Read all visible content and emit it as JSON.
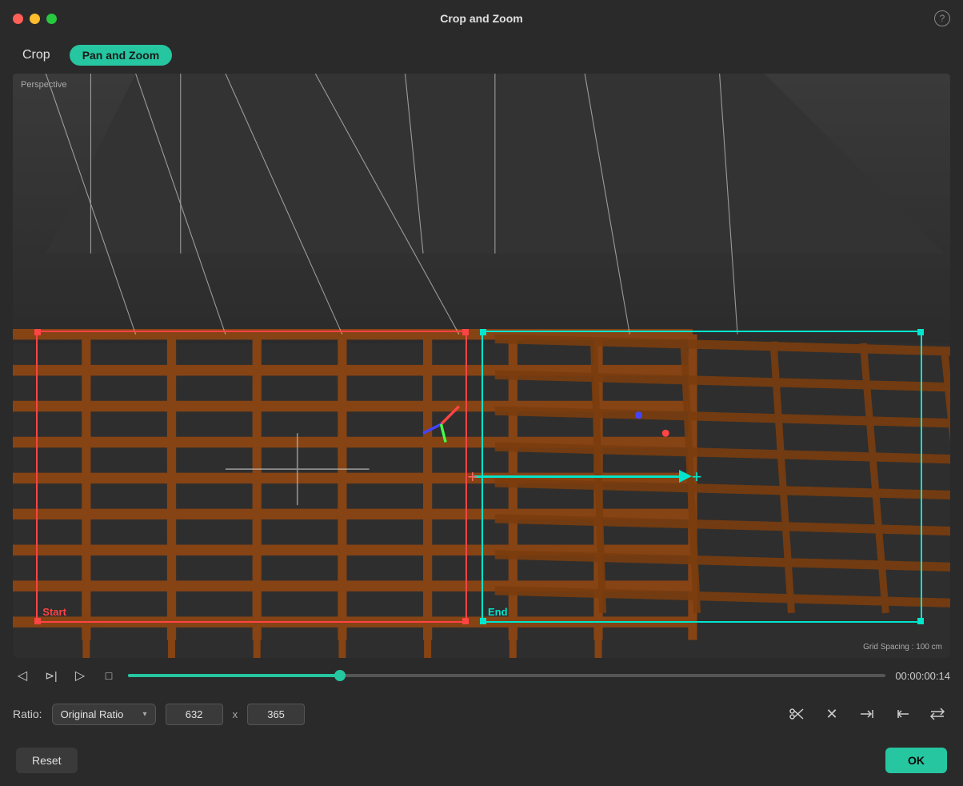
{
  "titlebar": {
    "title": "Crop and Zoom",
    "help_symbol": "?"
  },
  "tabs": {
    "crop_label": "Crop",
    "pan_zoom_label": "Pan and Zoom"
  },
  "scene": {
    "perspective_label": "Perspective",
    "grid_spacing_label": "Grid Spacing : 100 cm",
    "start_label": "Start",
    "end_label": "End"
  },
  "transport": {
    "timecode": "00:00:00:14",
    "timeline_progress": 28
  },
  "ratio": {
    "label": "Ratio:",
    "selected": "Original Ratio",
    "width": "632",
    "height": "365",
    "separator": "x"
  },
  "actions": {
    "reset_label": "Reset",
    "ok_label": "OK"
  },
  "icons": {
    "prev_frame": "◁",
    "play_from": "⊳|",
    "play": "▷",
    "stop": "□",
    "scissors": "✂",
    "close_x": "✕",
    "arrow_right_bar": "→|",
    "arrow_left_bar": "|←",
    "swap": "⇄"
  }
}
